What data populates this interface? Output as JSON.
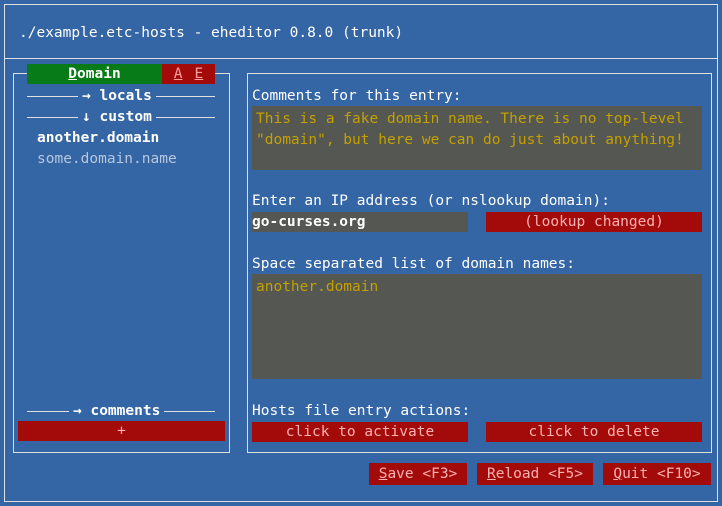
{
  "window": {
    "title": "./example.etc-hosts - eheditor 0.8.0 (trunk)"
  },
  "sidebar": {
    "tab_domain": "Domain",
    "tab_add": "A",
    "tab_edit": "E",
    "groups": {
      "locals": "→ locals",
      "custom": "↓ custom",
      "comments": "→ comments"
    },
    "items": [
      {
        "label": "another.domain",
        "selected": true
      },
      {
        "label": "some.domain.name",
        "selected": false
      }
    ],
    "add_button": "+"
  },
  "editor": {
    "comments_label": "Comments for this entry:",
    "comments_value": "This is a fake domain name. There is no top-level \"domain\", but here we can do just about anything!",
    "ip_label": "Enter an IP address (or nslookup domain):",
    "ip_value": "go-curses.org",
    "lookup_button": "(lookup changed)",
    "domains_label": "Space separated list of domain names:",
    "domains_value": "another.domain",
    "actions_label": "Hosts file entry actions:",
    "activate_button": "click to activate",
    "delete_button": "click to delete"
  },
  "footer": {
    "save_first": "S",
    "save_rest": "ave <F3>",
    "reload_first": "R",
    "reload_rest": "eload <F5>",
    "quit_first": "Q",
    "quit_rest": "uit <F10>"
  },
  "colors": {
    "background": "#3465a4",
    "button": "#a30b0b",
    "tab_active": "#077b18",
    "field": "#555753",
    "field_text": "#c4a000"
  }
}
